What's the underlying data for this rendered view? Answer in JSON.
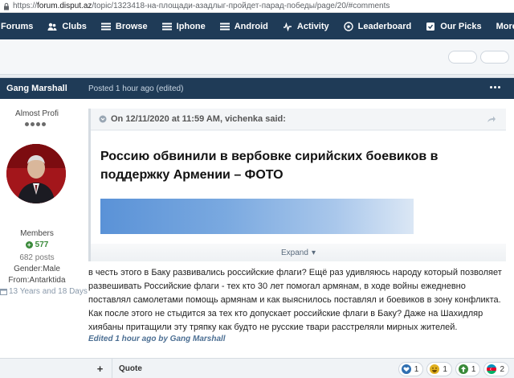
{
  "browser": {
    "url_scheme": "https://",
    "url_host": "forum.disput.az",
    "url_path": "/topic/1323418-на-площади-азадлыг-пройдет-парад-победы/page/20/#comments"
  },
  "nav": {
    "items": [
      {
        "label": "Forums",
        "icon": "forums-icon"
      },
      {
        "label": "Clubs",
        "icon": "clubs-icon"
      },
      {
        "label": "Browse",
        "icon": "browse-icon"
      },
      {
        "label": "Iphone",
        "icon": "iphone-icon"
      },
      {
        "label": "Android",
        "icon": "android-icon"
      },
      {
        "label": "Activity",
        "icon": "activity-icon"
      },
      {
        "label": "Leaderboard",
        "icon": "leaderboard-icon"
      },
      {
        "label": "Our Picks",
        "icon": "picks-icon"
      },
      {
        "label": "More",
        "icon": "caret-down-icon"
      }
    ]
  },
  "post": {
    "author": "Gang Marshall",
    "date": "Posted 1 hour ago (edited)",
    "author_panel": {
      "rank": "Almost Profi",
      "group": "Members",
      "reputation": "577",
      "posts": "682 posts",
      "gender": "Gender:Male",
      "from": "From:Antarktida",
      "days": "13 Years and 18 Days"
    },
    "quote": {
      "header": "On 12/11/2020 at 11:59 AM, vichenka said:",
      "article_title": "Россию обвинили в вербовке сирийских боевиков в поддержку Армении – ФОТО",
      "expand_label": "Expand"
    },
    "body": "в честь этого в Баку развивались российские флаги? Ещё раз удивляюсь народу который позволяет развешивать Российские флаги - тех кто 30 лет помогал армянам, в ходе войны ежедневно поставлял самолетами помощь армянам и как выяснилось поставлял и боевиков в зону конфликта. Как после этого не стыдится за тех кто допускает российские флаги в Баку? Даже на Шахидляр хиябаны притащили эту тряпку как будто не русские твари расстреляли мирных жителей.",
    "edited": "Edited 1 hour ago by Gang Marshall",
    "footer": {
      "plus_label": "+",
      "quote_label": "Quote",
      "reactions": [
        {
          "icon": "heart-icon",
          "count": "1",
          "color": "#2f6fb1"
        },
        {
          "icon": "haha-icon",
          "count": "1",
          "color": "#e0b020"
        },
        {
          "icon": "thumbs-up-icon",
          "count": "1",
          "color": "#3a8a3a"
        },
        {
          "icon": "azerbaijan-flag-icon",
          "count": "2",
          "color": "#0092bc"
        }
      ]
    }
  }
}
